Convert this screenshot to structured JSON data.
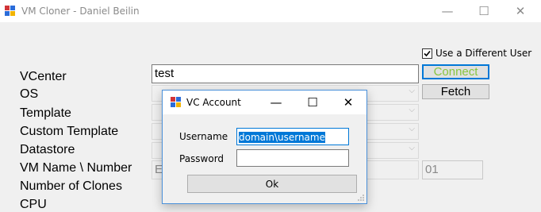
{
  "main_window": {
    "title": "VM Cloner - Daniel Beilin",
    "controls": {
      "minimize": "—",
      "maximize": "☐",
      "close": "✕"
    },
    "use_different_user": {
      "label": "Use a Different User",
      "checked": true
    },
    "labels": {
      "vcenter": "VCenter",
      "os": "OS",
      "template": "Template",
      "custom_template": "Custom Template",
      "datastore": "Datastore",
      "vm_name_number": "VM Name \\ Number",
      "number_of_clones": "Number of Clones",
      "cpu": "CPU"
    },
    "vcenter_value": "test",
    "vm_name_partial": "E",
    "vm_number_value": "01",
    "connect_label": "Connect",
    "fetch_label": "Fetch",
    "accent_colors": {
      "connect_text": "#88c540",
      "focus_border": "#0078d7"
    }
  },
  "dialog": {
    "title": "VC Account",
    "controls": {
      "minimize": "—",
      "maximize": "☐",
      "close": "✕"
    },
    "username_label": "Username",
    "username_value": "domain\\username",
    "password_label": "Password",
    "password_value": "",
    "ok_label": "Ok"
  }
}
